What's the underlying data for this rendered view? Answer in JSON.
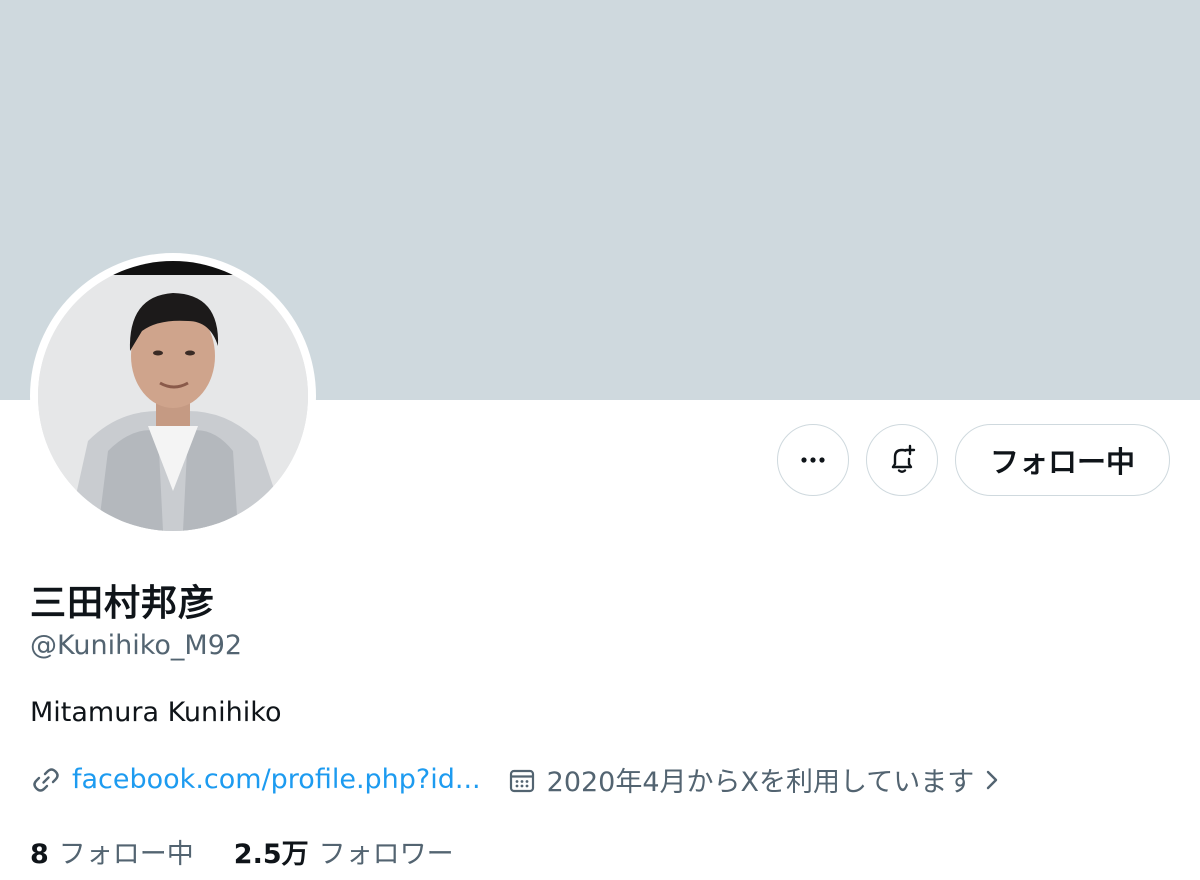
{
  "profile": {
    "display_name": "三田村邦彦",
    "handle": "@Kunihiko_M92",
    "bio": "Mitamura Kunihiko",
    "link_text": "facebook.com/profile.php?id...",
    "joined_text": "2020年4月からXを利用しています",
    "avatar_icon": "profile-photo"
  },
  "actions": {
    "more_icon": "more-horizontal-icon",
    "notify_icon": "bell-plus-icon",
    "follow_label": "フォロー中"
  },
  "stats": {
    "following_count": "8",
    "following_label": "フォロー中",
    "followers_count": "2.5万",
    "followers_label": "フォロワー"
  },
  "colors": {
    "banner": "#cfd9de",
    "link": "#1d9bf0",
    "secondary_text": "#536471",
    "primary_text": "#0f1419"
  }
}
